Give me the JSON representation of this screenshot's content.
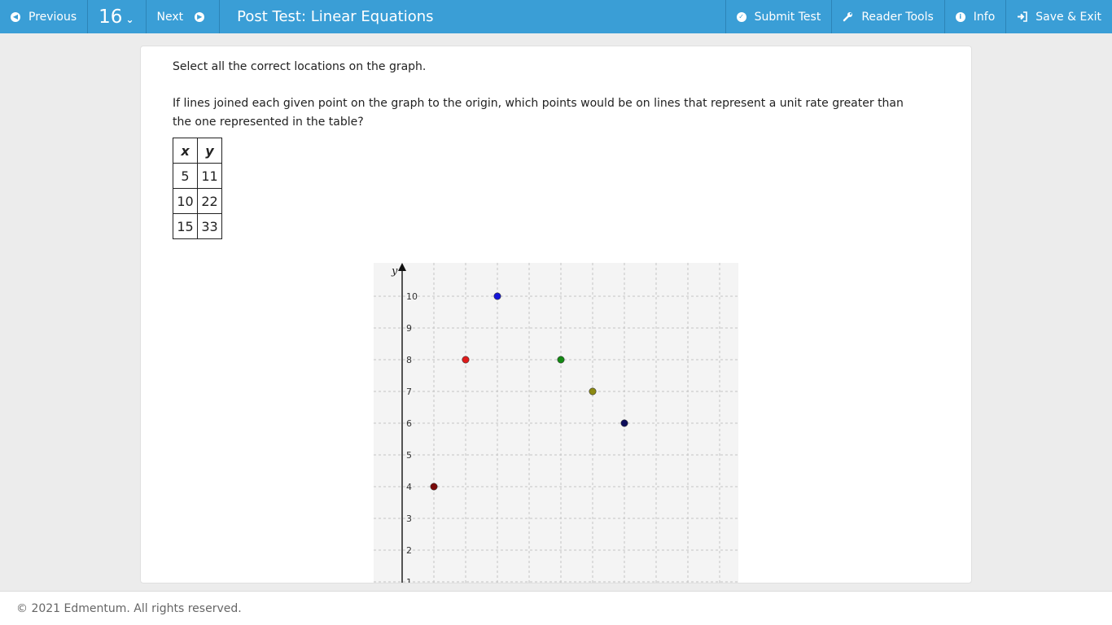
{
  "topbar": {
    "previous_label": "Previous",
    "question_number": "16",
    "next_label": "Next",
    "title": "Post Test: Linear Equations",
    "submit_label": "Submit Test",
    "reader_tools_label": "Reader Tools",
    "info_label": "Info",
    "save_exit_label": "Save & Exit"
  },
  "question": {
    "instruction": "Select all the correct locations on the graph.",
    "prompt": "If lines joined each given point on the graph to the origin, which points would be on lines that represent a unit rate greater than the one represented in the table?",
    "table": {
      "headers": [
        "x",
        "y"
      ],
      "rows": [
        [
          "5",
          "11"
        ],
        [
          "10",
          "22"
        ],
        [
          "15",
          "33"
        ]
      ]
    }
  },
  "chart_data": {
    "type": "scatter",
    "ylabel": "y",
    "y_ticks": [
      "1",
      "2",
      "3",
      "4",
      "5",
      "6",
      "7",
      "8",
      "9",
      "10"
    ],
    "ylim_visible": [
      1,
      10
    ],
    "grid": true,
    "points": [
      {
        "x": 1,
        "y": 4,
        "color": "#7a0a0a"
      },
      {
        "x": 2,
        "y": 8,
        "color": "#e01b1b"
      },
      {
        "x": 3,
        "y": 10,
        "color": "#1414d8"
      },
      {
        "x": 5,
        "y": 8,
        "color": "#138a13"
      },
      {
        "x": 6,
        "y": 7,
        "color": "#8c8a12"
      },
      {
        "x": 7,
        "y": 6,
        "color": "#0c0c5a"
      }
    ]
  },
  "footer": {
    "copyright": "© 2021 Edmentum. All rights reserved."
  }
}
